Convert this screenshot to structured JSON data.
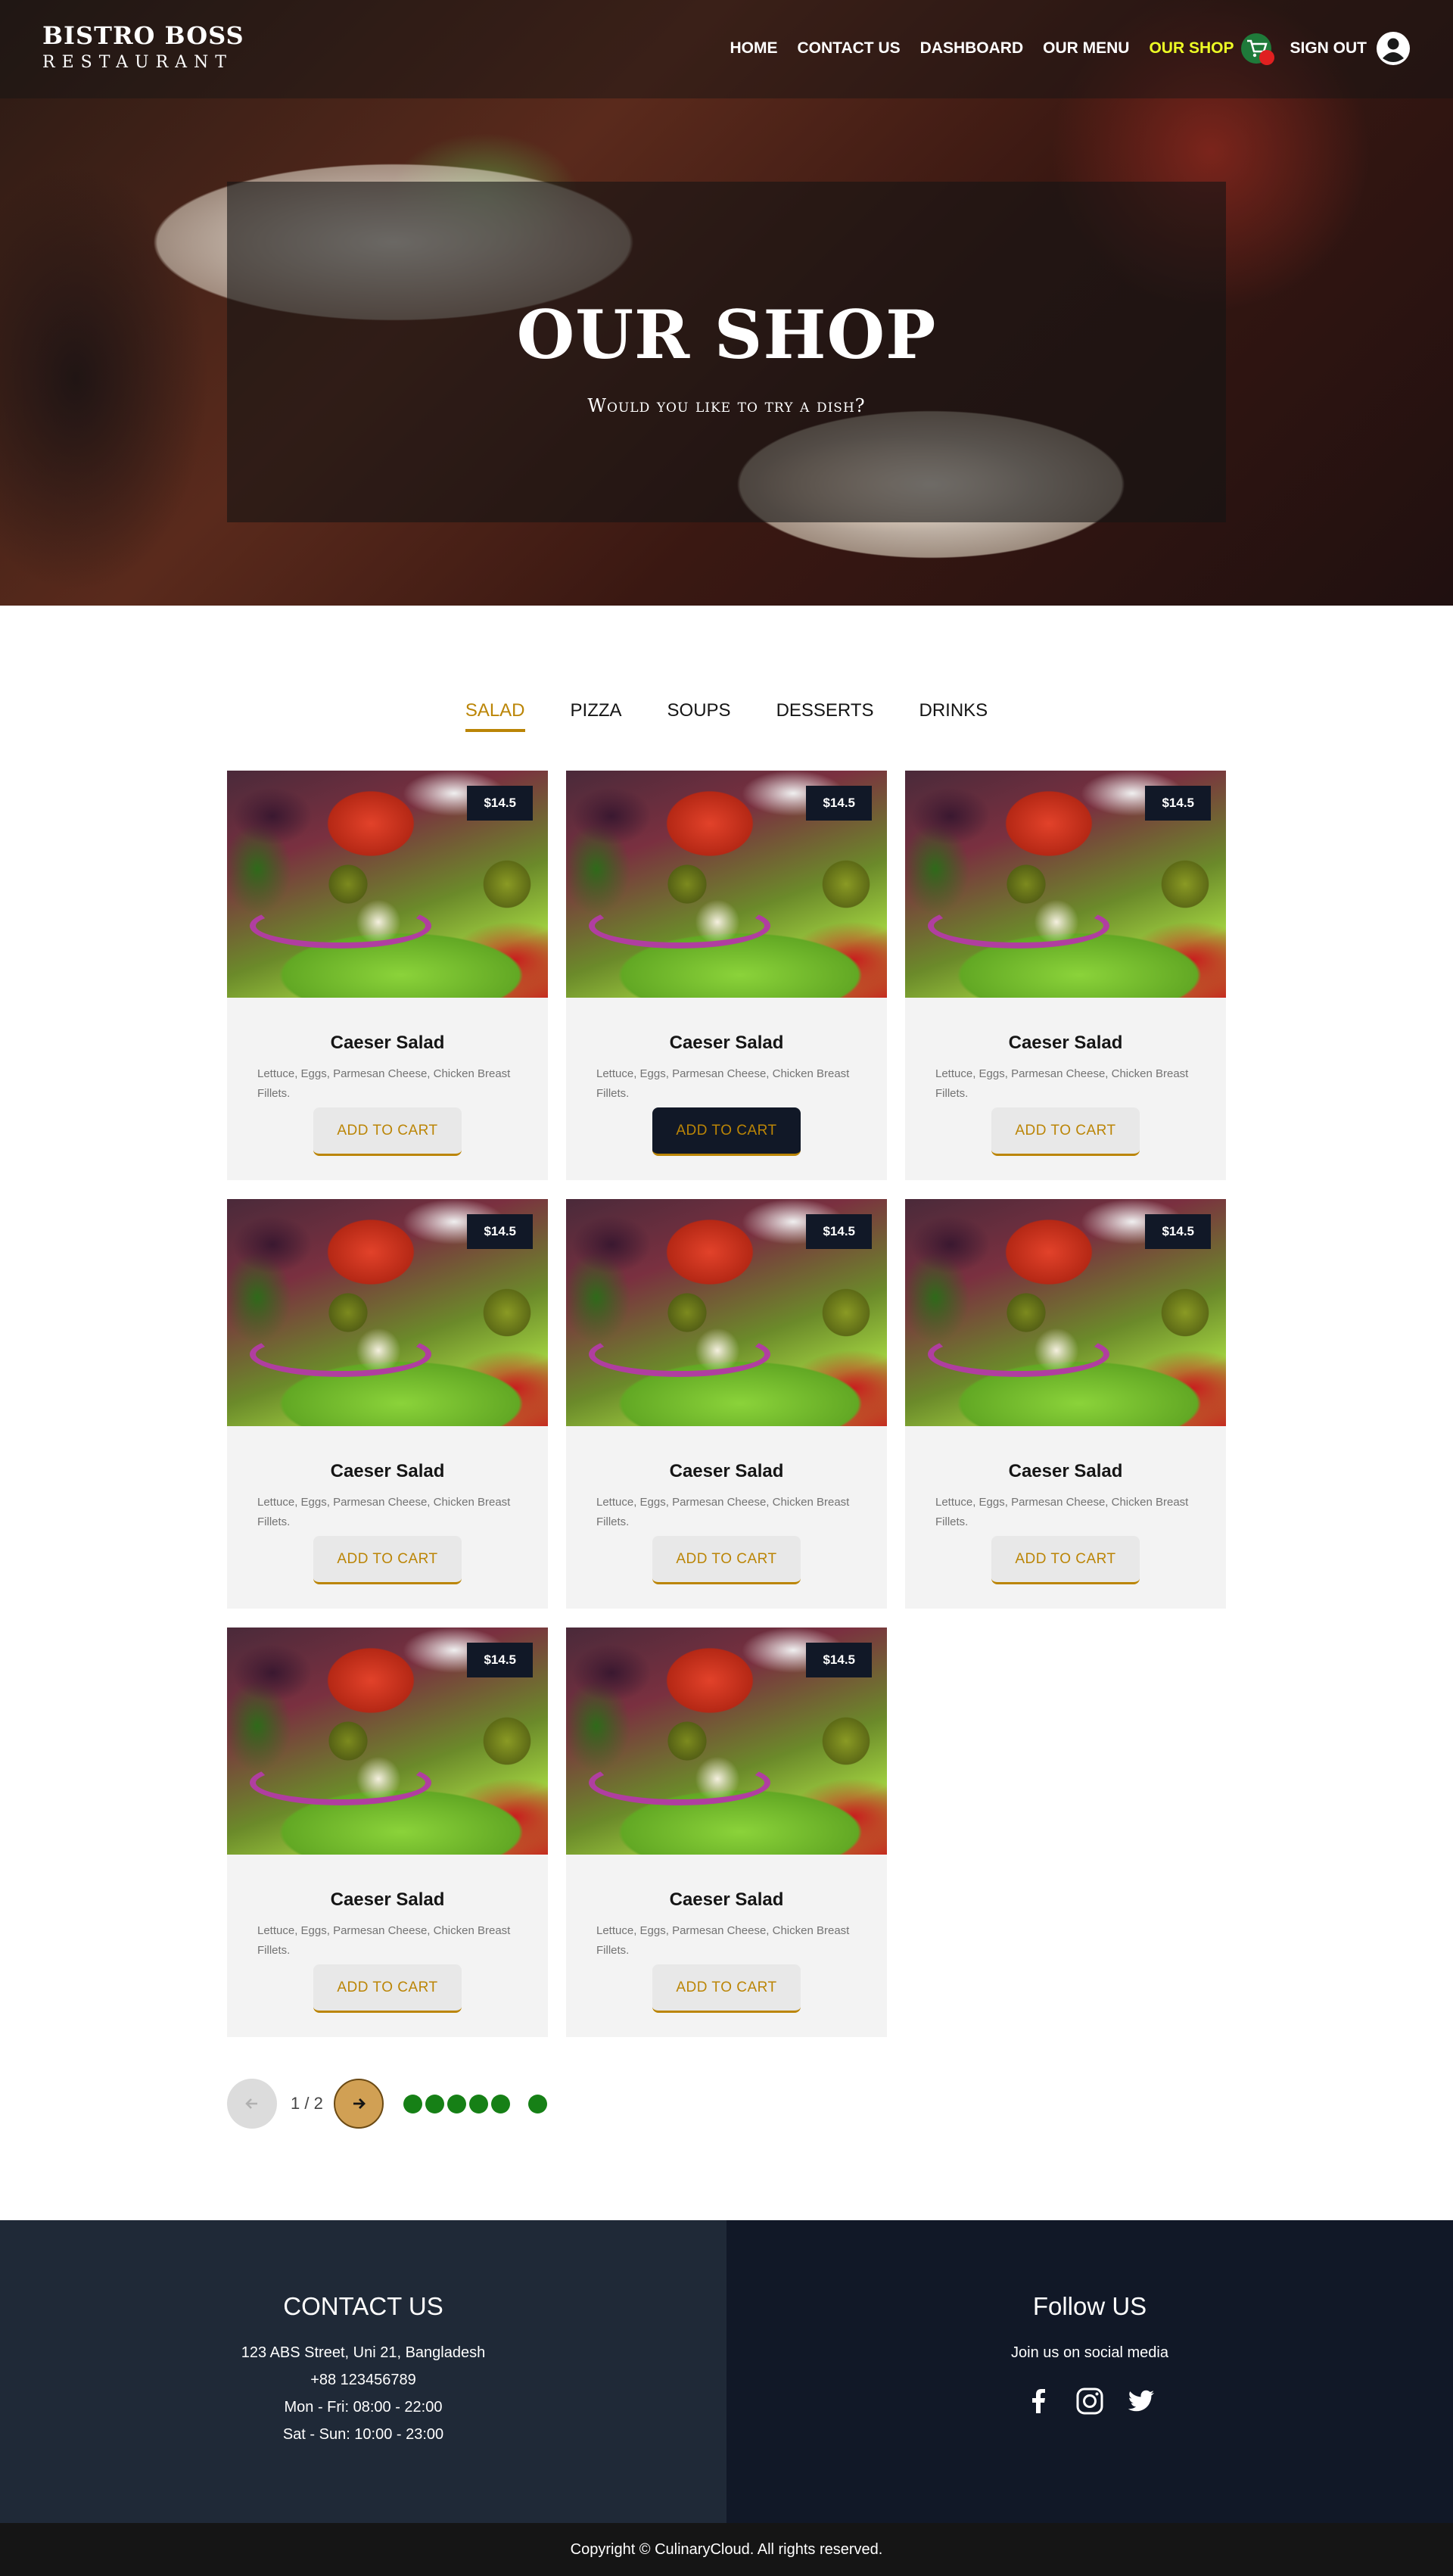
{
  "brand": {
    "title": "BISTRO BOSS",
    "subtitle": "Restaurant"
  },
  "nav": {
    "links": [
      "HOME",
      "CONTACT US",
      "DASHBOARD",
      "OUR MENU",
      "OUR SHOP",
      "SIGN OUT"
    ],
    "active": "OUR SHOP",
    "cart_icon": "cart-icon",
    "user_icon": "user-circle-icon"
  },
  "hero": {
    "title": "OUR SHOP",
    "subtitle": "Would you like to try a dish?"
  },
  "tabs": [
    "SALAD",
    "PIZZA",
    "SOUPS",
    "DESSERTS",
    "DRINKS"
  ],
  "active_tab": "SALAD",
  "products": [
    {
      "price": "$14.5",
      "name": "Caeser Salad",
      "desc": "Lettuce, Eggs, Parmesan Cheese, Chicken Breast Fillets.",
      "button": "ADD TO CART"
    },
    {
      "price": "$14.5",
      "name": "Caeser Salad",
      "desc": "Lettuce, Eggs, Parmesan Cheese, Chicken Breast Fillets.",
      "button": "ADD TO CART"
    },
    {
      "price": "$14.5",
      "name": "Caeser Salad",
      "desc": "Lettuce, Eggs, Parmesan Cheese, Chicken Breast Fillets.",
      "button": "ADD TO CART"
    },
    {
      "price": "$14.5",
      "name": "Caeser Salad",
      "desc": "Lettuce, Eggs, Parmesan Cheese, Chicken Breast Fillets.",
      "button": "ADD TO CART"
    },
    {
      "price": "$14.5",
      "name": "Caeser Salad",
      "desc": "Lettuce, Eggs, Parmesan Cheese, Chicken Breast Fillets.",
      "button": "ADD TO CART"
    },
    {
      "price": "$14.5",
      "name": "Caeser Salad",
      "desc": "Lettuce, Eggs, Parmesan Cheese, Chicken Breast Fillets.",
      "button": "ADD TO CART"
    },
    {
      "price": "$14.5",
      "name": "Caeser Salad",
      "desc": "Lettuce, Eggs, Parmesan Cheese, Chicken Breast Fillets.",
      "button": "ADD TO CART"
    },
    {
      "price": "$14.5",
      "name": "Caeser Salad",
      "desc": "Lettuce, Eggs, Parmesan Cheese, Chicken Breast Fillets.",
      "button": "ADD TO CART"
    }
  ],
  "pagination": {
    "text": "1 / 2",
    "prev_icon": "arrow-left-icon",
    "next_icon": "arrow-right-icon"
  },
  "footer": {
    "contact_title": "CONTACT US",
    "contact_lines": [
      "123 ABS Street, Uni 21, Bangladesh",
      "+88 123456789",
      "Mon - Fri: 08:00 - 22:00",
      "Sat - Sun: 10:00 - 23:00"
    ],
    "follow_title": "Follow US",
    "follow_sub": "Join us on social media",
    "social_icons": [
      "facebook-icon",
      "instagram-icon",
      "twitter-icon"
    ],
    "copyright": "Copyright © CulinaryCloud. All rights reserved."
  },
  "colors": {
    "accent": "#bb8506",
    "nav_active": "#eeff25",
    "dark": "#111827",
    "dot_green": "#168016"
  }
}
